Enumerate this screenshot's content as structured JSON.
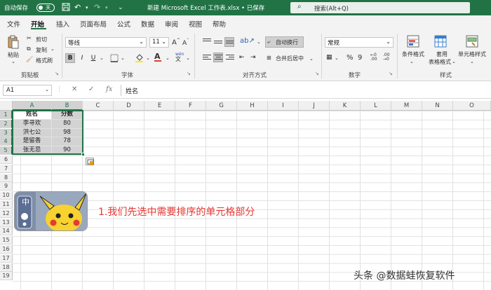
{
  "titlebar": {
    "autosave_label": "自动保存",
    "autosave_state": "关",
    "doc_title": "新建 Microsoft Excel 工作表.xlsx • 已保存",
    "search_placeholder": "搜索(Alt+Q)"
  },
  "menu": {
    "tabs": [
      "文件",
      "开始",
      "插入",
      "页面布局",
      "公式",
      "数据",
      "审阅",
      "视图",
      "帮助"
    ],
    "active_tab": "开始"
  },
  "ribbon": {
    "clipboard": {
      "paste": "粘贴",
      "cut": "剪切",
      "copy": "复制",
      "format_painter": "格式刷",
      "group": "剪贴板"
    },
    "font": {
      "name": "等线",
      "size": "11",
      "bold": "B",
      "italic": "I",
      "underline": "U",
      "grow": "A",
      "shrink": "A",
      "group": "字体"
    },
    "alignment": {
      "wrap": "自动换行",
      "merge": "合并后居中",
      "group": "对齐方式"
    },
    "number": {
      "format": "常规",
      "group": "数字"
    },
    "styles": {
      "conditional": "条件格式",
      "table_l1": "套用",
      "table_l2": "表格格式",
      "cell_styles": "单元格样式",
      "group": "样式"
    }
  },
  "formula_bar": {
    "name_box": "A1",
    "cancel": "✕",
    "enter": "✓",
    "fx": "fx",
    "content": "姓名"
  },
  "grid": {
    "columns": [
      "A",
      "B",
      "C",
      "D",
      "E",
      "F",
      "G",
      "H",
      "I",
      "J",
      "K",
      "L",
      "M",
      "N",
      "O"
    ],
    "rows": [
      "1",
      "2",
      "3",
      "4",
      "5",
      "6",
      "7",
      "8",
      "9",
      "10",
      "11",
      "12",
      "13",
      "14",
      "15",
      "16",
      "17",
      "18",
      "19"
    ],
    "cells": [
      [
        "姓名",
        "分数"
      ],
      [
        "李寻欢",
        "80"
      ],
      [
        "洪七公",
        "98"
      ],
      [
        "楚留香",
        "78"
      ],
      [
        "张无忌",
        "90"
      ]
    ]
  },
  "overlay": {
    "instruction": "1.我们先选中需要排序的单元格部分",
    "badge_char": "中",
    "watermark": "头条 @数据蛙恢复软件"
  },
  "colors": {
    "accent": "#217346",
    "annotation": "#e53935"
  }
}
